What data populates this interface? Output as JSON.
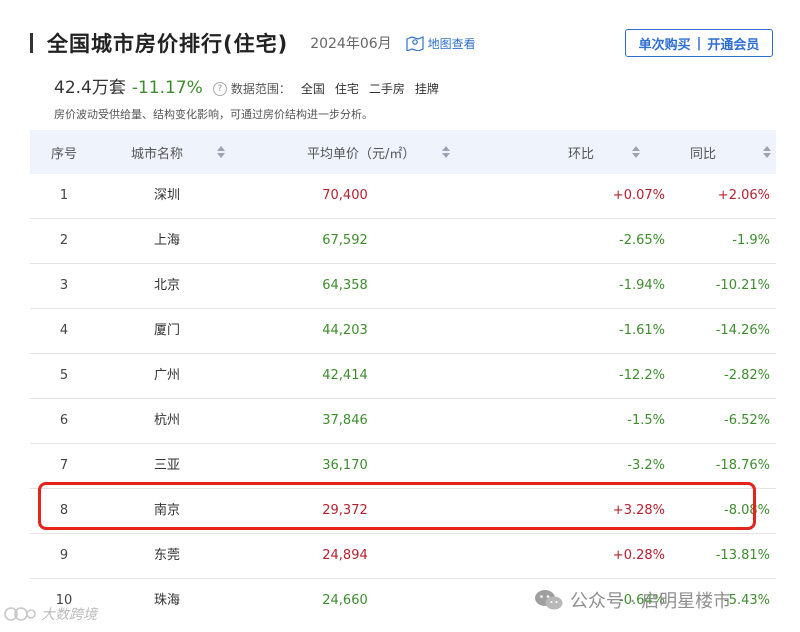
{
  "header": {
    "title": "全国城市房价排行(住宅)",
    "date": "2024年06月",
    "map_link": "地图查看",
    "buy_once": "单次购买",
    "separator": "|",
    "open_vip": "开通会员"
  },
  "summary": {
    "total": "42.4万套",
    "change": "-11.17%",
    "help_glyph": "?",
    "scope_label": "数据范围：",
    "scope_items": [
      "全国",
      "住宅",
      "二手房",
      "挂牌"
    ],
    "note": "房价波动受供给量、结构变化影响，可通过房价结构进一步分析。"
  },
  "table": {
    "headers": {
      "rank": "序号",
      "city": "城市名称",
      "price": "平均单价（元/㎡）",
      "mom": "环比",
      "yoy": "同比"
    },
    "rows": [
      {
        "rank": "1",
        "city": "深圳",
        "price": "70,400",
        "price_color": "red",
        "mom": "+0.07%",
        "mom_color": "red",
        "yoy": "+2.06%",
        "yoy_color": "red"
      },
      {
        "rank": "2",
        "city": "上海",
        "price": "67,592",
        "price_color": "green",
        "mom": "-2.65%",
        "mom_color": "green",
        "yoy": "-1.9%",
        "yoy_color": "green"
      },
      {
        "rank": "3",
        "city": "北京",
        "price": "64,358",
        "price_color": "green",
        "mom": "-1.94%",
        "mom_color": "green",
        "yoy": "-10.21%",
        "yoy_color": "green"
      },
      {
        "rank": "4",
        "city": "厦门",
        "price": "44,203",
        "price_color": "green",
        "mom": "-1.61%",
        "mom_color": "green",
        "yoy": "-14.26%",
        "yoy_color": "green"
      },
      {
        "rank": "5",
        "city": "广州",
        "price": "42,414",
        "price_color": "green",
        "mom": "-12.2%",
        "mom_color": "green",
        "yoy": "-2.82%",
        "yoy_color": "green"
      },
      {
        "rank": "6",
        "city": "杭州",
        "price": "37,846",
        "price_color": "green",
        "mom": "-1.5%",
        "mom_color": "green",
        "yoy": "-6.52%",
        "yoy_color": "green"
      },
      {
        "rank": "7",
        "city": "三亚",
        "price": "36,170",
        "price_color": "green",
        "mom": "-3.2%",
        "mom_color": "green",
        "yoy": "-18.76%",
        "yoy_color": "green"
      },
      {
        "rank": "8",
        "city": "南京",
        "price": "29,372",
        "price_color": "red",
        "mom": "+3.28%",
        "mom_color": "red",
        "yoy": "-8.08%",
        "yoy_color": "green"
      },
      {
        "rank": "9",
        "city": "东莞",
        "price": "24,894",
        "price_color": "red",
        "mom": "+0.28%",
        "mom_color": "red",
        "yoy": "-13.81%",
        "yoy_color": "green"
      },
      {
        "rank": "10",
        "city": "珠海",
        "price": "24,660",
        "price_color": "green",
        "mom": "-0.64%",
        "mom_color": "green",
        "yoy": "-5.43%",
        "yoy_color": "green"
      }
    ]
  },
  "watermarks": {
    "right": "公众号 · 启明星楼市",
    "left": "大数跨境"
  },
  "colors": {
    "red": "#b8202e",
    "green": "#3d8d2e",
    "accent": "#2f6fd2",
    "highlight": "#e6231b",
    "header_bg": "#eef3fc"
  }
}
